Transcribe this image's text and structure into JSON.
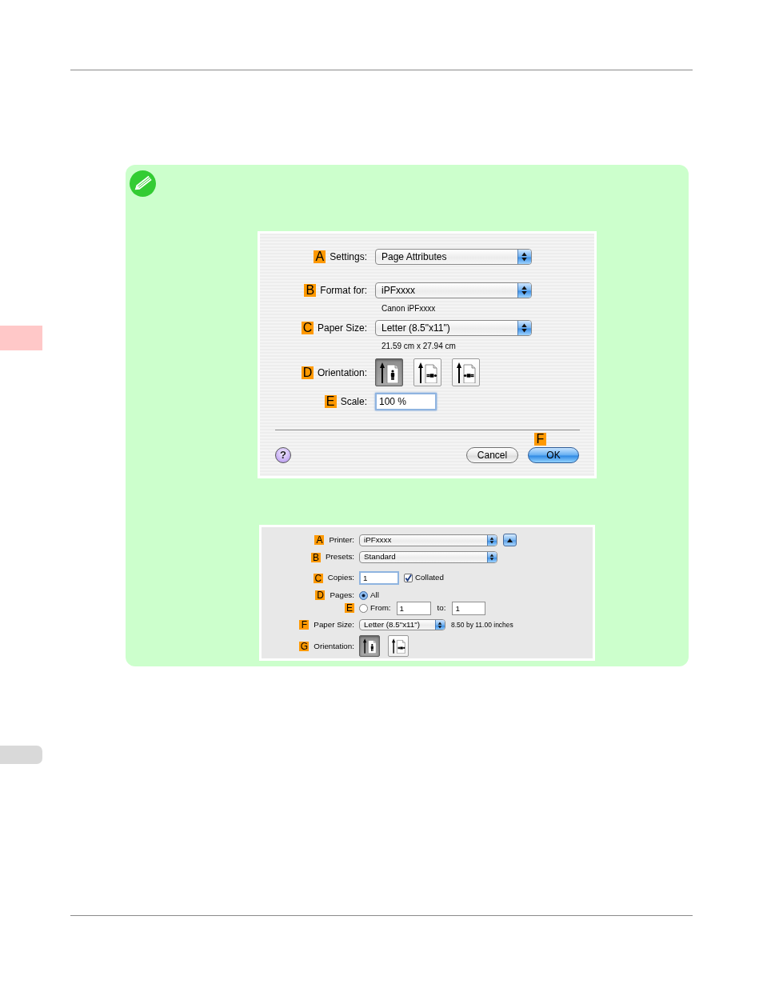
{
  "side_tabs": [
    {
      "selected": true
    },
    {
      "selected": false
    }
  ],
  "page_setup": {
    "rows": [
      {
        "kind": "popup",
        "marker": "A",
        "label": "Settings:",
        "value": "Page Attributes"
      },
      {
        "kind": "popup",
        "marker": "B",
        "label": "Format for:",
        "value": "iPFxxxx",
        "detail": "Canon iPFxxxx"
      },
      {
        "kind": "popup",
        "marker": "C",
        "label": "Paper Size:",
        "value": "Letter (8.5\"x11\")",
        "detail": "21.59 cm x 27.94 cm"
      },
      {
        "kind": "orientation",
        "marker": "D",
        "label": "Orientation:",
        "options": [
          {
            "kind": "portrait",
            "selected": true
          },
          {
            "kind": "landscape",
            "selected": false
          },
          {
            "kind": "reverse_landscape",
            "selected": false
          }
        ]
      },
      {
        "kind": "text",
        "marker": "E",
        "label": "Scale:",
        "value": "100 %"
      }
    ],
    "help_button": "?",
    "buttons": [
      {
        "kind": "cancel",
        "label": "Cancel"
      },
      {
        "kind": "default",
        "label": "OK",
        "marker": "F"
      }
    ]
  },
  "print": {
    "rows": [
      {
        "kind": "popup",
        "marker": "A",
        "label": "Printer:",
        "value": "iPFxxxx",
        "disclosure_button": true
      },
      {
        "kind": "popup",
        "marker": "B",
        "label": "Presets:",
        "value": "Standard"
      },
      {
        "kind": "copies",
        "marker": "C",
        "label": "Copies:",
        "value": "1",
        "checkbox": {
          "label": "Collated",
          "checked": true
        }
      },
      {
        "kind": "radio",
        "marker": "D",
        "label": "Pages:",
        "radio": {
          "label": "All",
          "selected": true
        }
      },
      {
        "kind": "radio",
        "marker": "E",
        "radio": {
          "label": "From:",
          "selected": false
        },
        "range": {
          "from": "1",
          "to_label": "to:",
          "to": "1"
        }
      },
      {
        "kind": "popup",
        "marker": "F",
        "label": "Paper Size:",
        "value": "Letter (8.5\"x11\")",
        "detail": "8.50 by 11.00 inches"
      },
      {
        "kind": "orientation",
        "marker": "G",
        "label": "Orientation:",
        "options": [
          {
            "kind": "portrait",
            "selected": true
          },
          {
            "kind": "landscape",
            "selected": false
          }
        ]
      }
    ]
  }
}
